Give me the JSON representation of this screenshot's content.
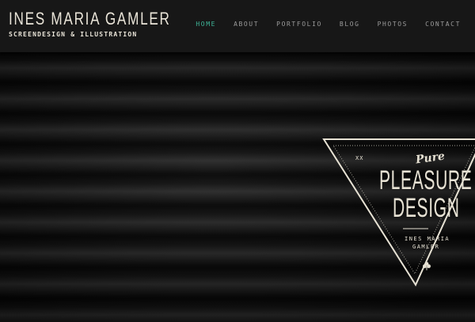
{
  "header": {
    "title": "INES MARIA GAMLER",
    "subtitle": "SCREENDESIGN & ILLUSTRATION"
  },
  "nav": {
    "items": [
      {
        "label": "HOME",
        "active": true
      },
      {
        "label": "ABOUT",
        "active": false
      },
      {
        "label": "PORTFOLIO",
        "active": false
      },
      {
        "label": "BLOG",
        "active": false
      },
      {
        "label": "PHOTOS",
        "active": false
      },
      {
        "label": "CONTACT",
        "active": false
      }
    ],
    "active_color": "#3fb79a"
  },
  "hero": {
    "background": "corrugated-metal-texture",
    "badge": {
      "marker": "XX",
      "script": "Pure",
      "line1": "PLEASURE",
      "line2": "DESIGN",
      "name_line1": "INES MARIA",
      "name_line2": "GAMLER",
      "icon": "clover-icon"
    }
  },
  "colors": {
    "header_bg": "#171717",
    "text": "#e9e4d8",
    "nav_text": "#9a9a9a"
  }
}
